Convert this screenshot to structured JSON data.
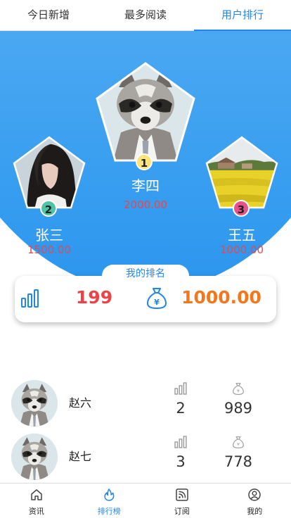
{
  "tabs": [
    {
      "label": "今日新增",
      "active": false
    },
    {
      "label": "最多阅读",
      "active": false
    },
    {
      "label": "用户排行",
      "active": true
    }
  ],
  "podium": {
    "first": {
      "rank": "1",
      "name": "李四",
      "score": "2000.00",
      "badge_color": "#fde47a",
      "avatar": "raccoon-avatar"
    },
    "second": {
      "rank": "2",
      "name": "张三",
      "score": "1500.00",
      "badge_color": "#4fc3a8",
      "avatar": "woman-portrait-avatar"
    },
    "third": {
      "rank": "3",
      "name": "王五",
      "score": "1000.00",
      "badge_color": "#e8528a",
      "avatar": "rapeseed-field-avatar"
    }
  },
  "my_rank": {
    "title": "我的排名",
    "rank": "199",
    "score": "1000.00",
    "rank_icon": "bar-chart-icon",
    "score_icon": "money-bag-icon"
  },
  "list": [
    {
      "name": "赵六",
      "rank": "2",
      "score": "989",
      "avatar": "raccoon-avatar"
    },
    {
      "name": "赵七",
      "rank": "3",
      "score": "778",
      "avatar": "raccoon-avatar"
    }
  ],
  "bottom_nav": [
    {
      "label": "资讯",
      "icon": "home-icon",
      "active": false
    },
    {
      "label": "排行榜",
      "icon": "flame-icon",
      "active": true
    },
    {
      "label": "订阅",
      "icon": "rss-icon",
      "active": false
    },
    {
      "label": "我的",
      "icon": "user-icon",
      "active": false
    }
  ],
  "colors": {
    "accent": "#1f86ec",
    "rank_red": "#ec4347",
    "score_orange": "#f2781e",
    "podium_score": "#e04a52"
  }
}
